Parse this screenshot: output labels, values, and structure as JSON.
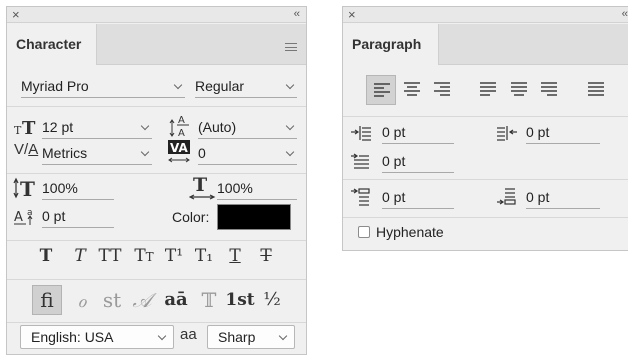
{
  "character": {
    "tab": "Character",
    "font_family": "Myriad Pro",
    "font_style": "Regular",
    "font_size": "12 pt",
    "leading": "(Auto)",
    "kerning": "Metrics",
    "tracking": "0",
    "vertical_scale": "100%",
    "horizontal_scale": "100%",
    "baseline_shift": "0 pt",
    "color_label": "Color:",
    "color_value": "#000000",
    "type_buttons": [
      "T",
      "T",
      "TT",
      "Tt",
      "T¹",
      "T₁",
      "T",
      "T"
    ],
    "opentype_buttons": [
      "fi",
      "ℴ",
      "st",
      "𝒜",
      "aā",
      "𝕋",
      "1st",
      "½"
    ],
    "language": "English: USA",
    "antialias_icon_text": "aa",
    "antialias": "Sharp"
  },
  "paragraph": {
    "tab": "Paragraph",
    "indent_left": "0 pt",
    "indent_right": "0 pt",
    "indent_first": "0 pt",
    "space_before": "0 pt",
    "space_after": "0 pt",
    "hyphenate_label": "Hyphenate"
  },
  "icons": {
    "close": "×",
    "collapse": "‹‹",
    "leading_glyph": "A",
    "tracking_glyph": "VA"
  }
}
